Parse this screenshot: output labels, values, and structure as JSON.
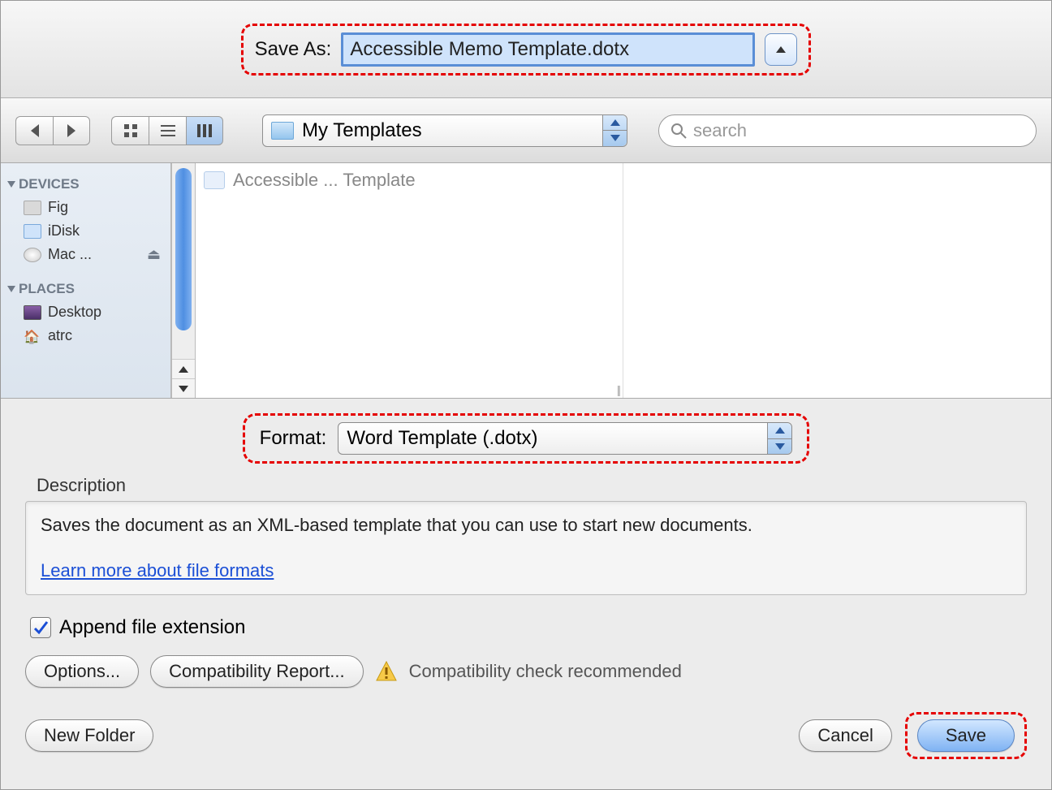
{
  "top": {
    "save_as_label": "Save As:",
    "filename": "Accessible Memo Template.dotx"
  },
  "toolbar": {
    "path_label": "My Templates",
    "search_placeholder": "search"
  },
  "sidebar": {
    "devices_header": "DEVICES",
    "devices": [
      {
        "label": "Fig"
      },
      {
        "label": "iDisk"
      },
      {
        "label": "Mac ...",
        "ejectable": true
      }
    ],
    "places_header": "PLACES",
    "places": [
      {
        "label": "Desktop"
      },
      {
        "label": "atrc"
      }
    ]
  },
  "file_list": {
    "item1": "Accessible ... Template"
  },
  "format": {
    "label": "Format:",
    "value": "Word Template (.dotx)"
  },
  "description": {
    "header": "Description",
    "text": "Saves the document as an XML-based template that you can use to start new documents.",
    "learn_link": "Learn more about file formats"
  },
  "append_checkbox": {
    "label": "Append file extension",
    "checked": true
  },
  "buttons": {
    "options": "Options...",
    "compat_report": "Compatibility Report...",
    "compat_warning": "Compatibility check recommended",
    "new_folder": "New Folder",
    "cancel": "Cancel",
    "save": "Save"
  }
}
